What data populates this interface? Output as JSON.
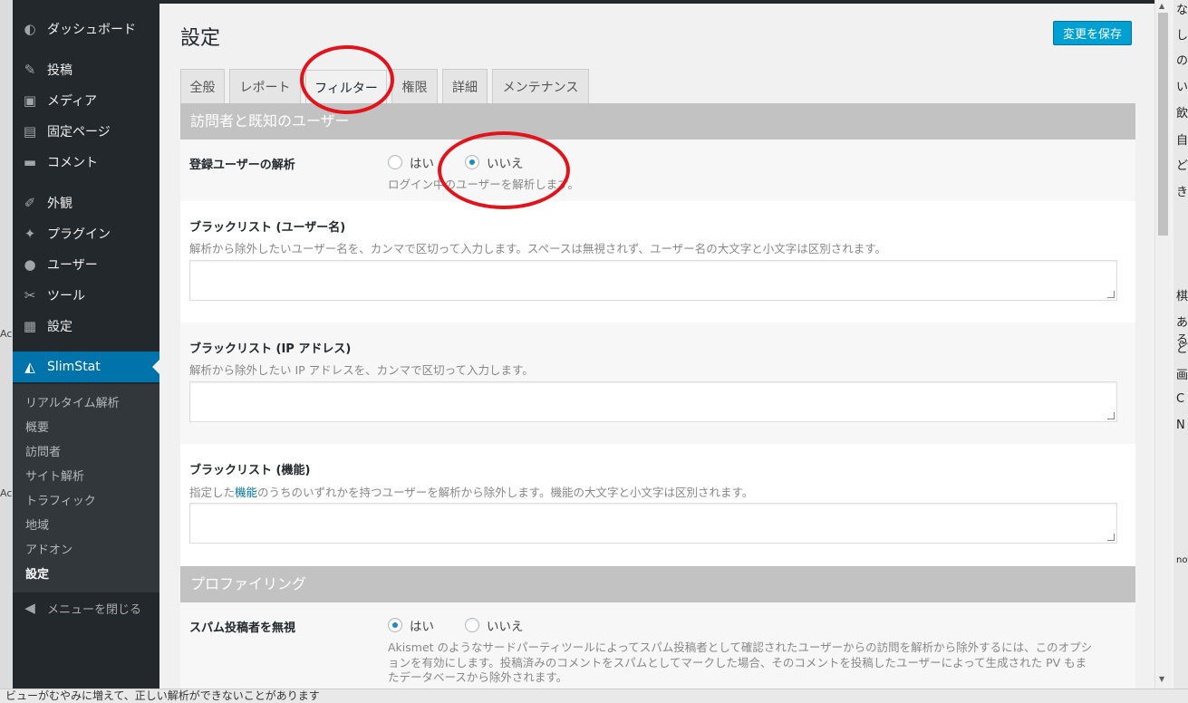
{
  "left_strip": {
    "texts": [
      "Ac",
      "Ac"
    ]
  },
  "sidebar": {
    "items": [
      {
        "icon": "dashboard-icon",
        "glyph": "◐",
        "label": "ダッシュボード"
      },
      {
        "icon": "pin-icon",
        "glyph": "✎",
        "label": "投稿"
      },
      {
        "icon": "media-icon",
        "glyph": "▣",
        "label": "メディア"
      },
      {
        "icon": "page-icon",
        "glyph": "▤",
        "label": "固定ページ"
      },
      {
        "icon": "comment-icon",
        "glyph": "▬",
        "label": "コメント"
      },
      {
        "icon": "appearance-icon",
        "glyph": "✐",
        "label": "外観"
      },
      {
        "icon": "plugin-icon",
        "glyph": "✦",
        "label": "プラグイン"
      },
      {
        "icon": "user-icon",
        "glyph": "●",
        "label": "ユーザー"
      },
      {
        "icon": "tool-icon",
        "glyph": "✂",
        "label": "ツール"
      },
      {
        "icon": "settings-icon",
        "glyph": "▦",
        "label": "設定"
      }
    ],
    "active": {
      "icon": "chart-icon",
      "glyph": "◭",
      "label": "SlimStat"
    },
    "submenu": [
      "リアルタイム解析",
      "概要",
      "訪問者",
      "サイト解析",
      "トラフィック",
      "地域",
      "アドオン",
      "設定"
    ],
    "collapse": {
      "icon": "collapse-icon",
      "glyph": "◀",
      "label": "メニューを閉じる"
    }
  },
  "page": {
    "title": "設定",
    "save_label": "変更を保存"
  },
  "tabs": [
    "全般",
    "レポート",
    "フィルター",
    "権限",
    "詳細",
    "メンテナンス"
  ],
  "sections": {
    "visitors": {
      "header": "訪問者と既知のユーザー",
      "track_users": {
        "label": "登録ユーザーの解析",
        "yes": "はい",
        "no": "いいえ",
        "desc": "ログイン中のユーザーを解析します。"
      },
      "bl_user": {
        "label": "ブラックリスト (ユーザー名)",
        "desc": "解析から除外したいユーザー名を、カンマで区切って入力します。スペースは無視されず、ユーザー名の大文字と小文字は区別されます。"
      },
      "bl_ip": {
        "label": "ブラックリスト (IP アドレス)",
        "desc": "解析から除外したい IP アドレスを、カンマで区切って入力します。"
      },
      "bl_cap": {
        "label": "ブラックリスト (機能)",
        "desc_pre": "指定した",
        "desc_link": "機能",
        "desc_post": "のうちのいずれかを持つユーザーを解析から除外します。機能の大文字と小文字は区別されます。"
      }
    },
    "profiling": {
      "header": "プロファイリング",
      "spam": {
        "label": "スパム投稿者を無視",
        "yes": "はい",
        "no": "いいえ",
        "desc1": "Akismet のようなサードパーティツールによってスパム投稿者として確認されたユーザーからの訪問を解析から除外するには、このオプシ",
        "desc2": "ョンを有効にします。投稿済みのコメントをスパムとしてマークした場合、そのコメントを投稿したユーザーによって生成された PV もま",
        "desc3": "たデータベースから除外されます。"
      }
    }
  },
  "bottom_text": "ビューがむやみに増えて、正しい解析ができないことがあります",
  "right_strip": [
    "な",
    "し",
    "の",
    "い",
    "飲",
    "自",
    "ど",
    "き",
    "棋",
    "ある",
    "ど",
    "画",
    "C",
    "N",
    "not"
  ]
}
